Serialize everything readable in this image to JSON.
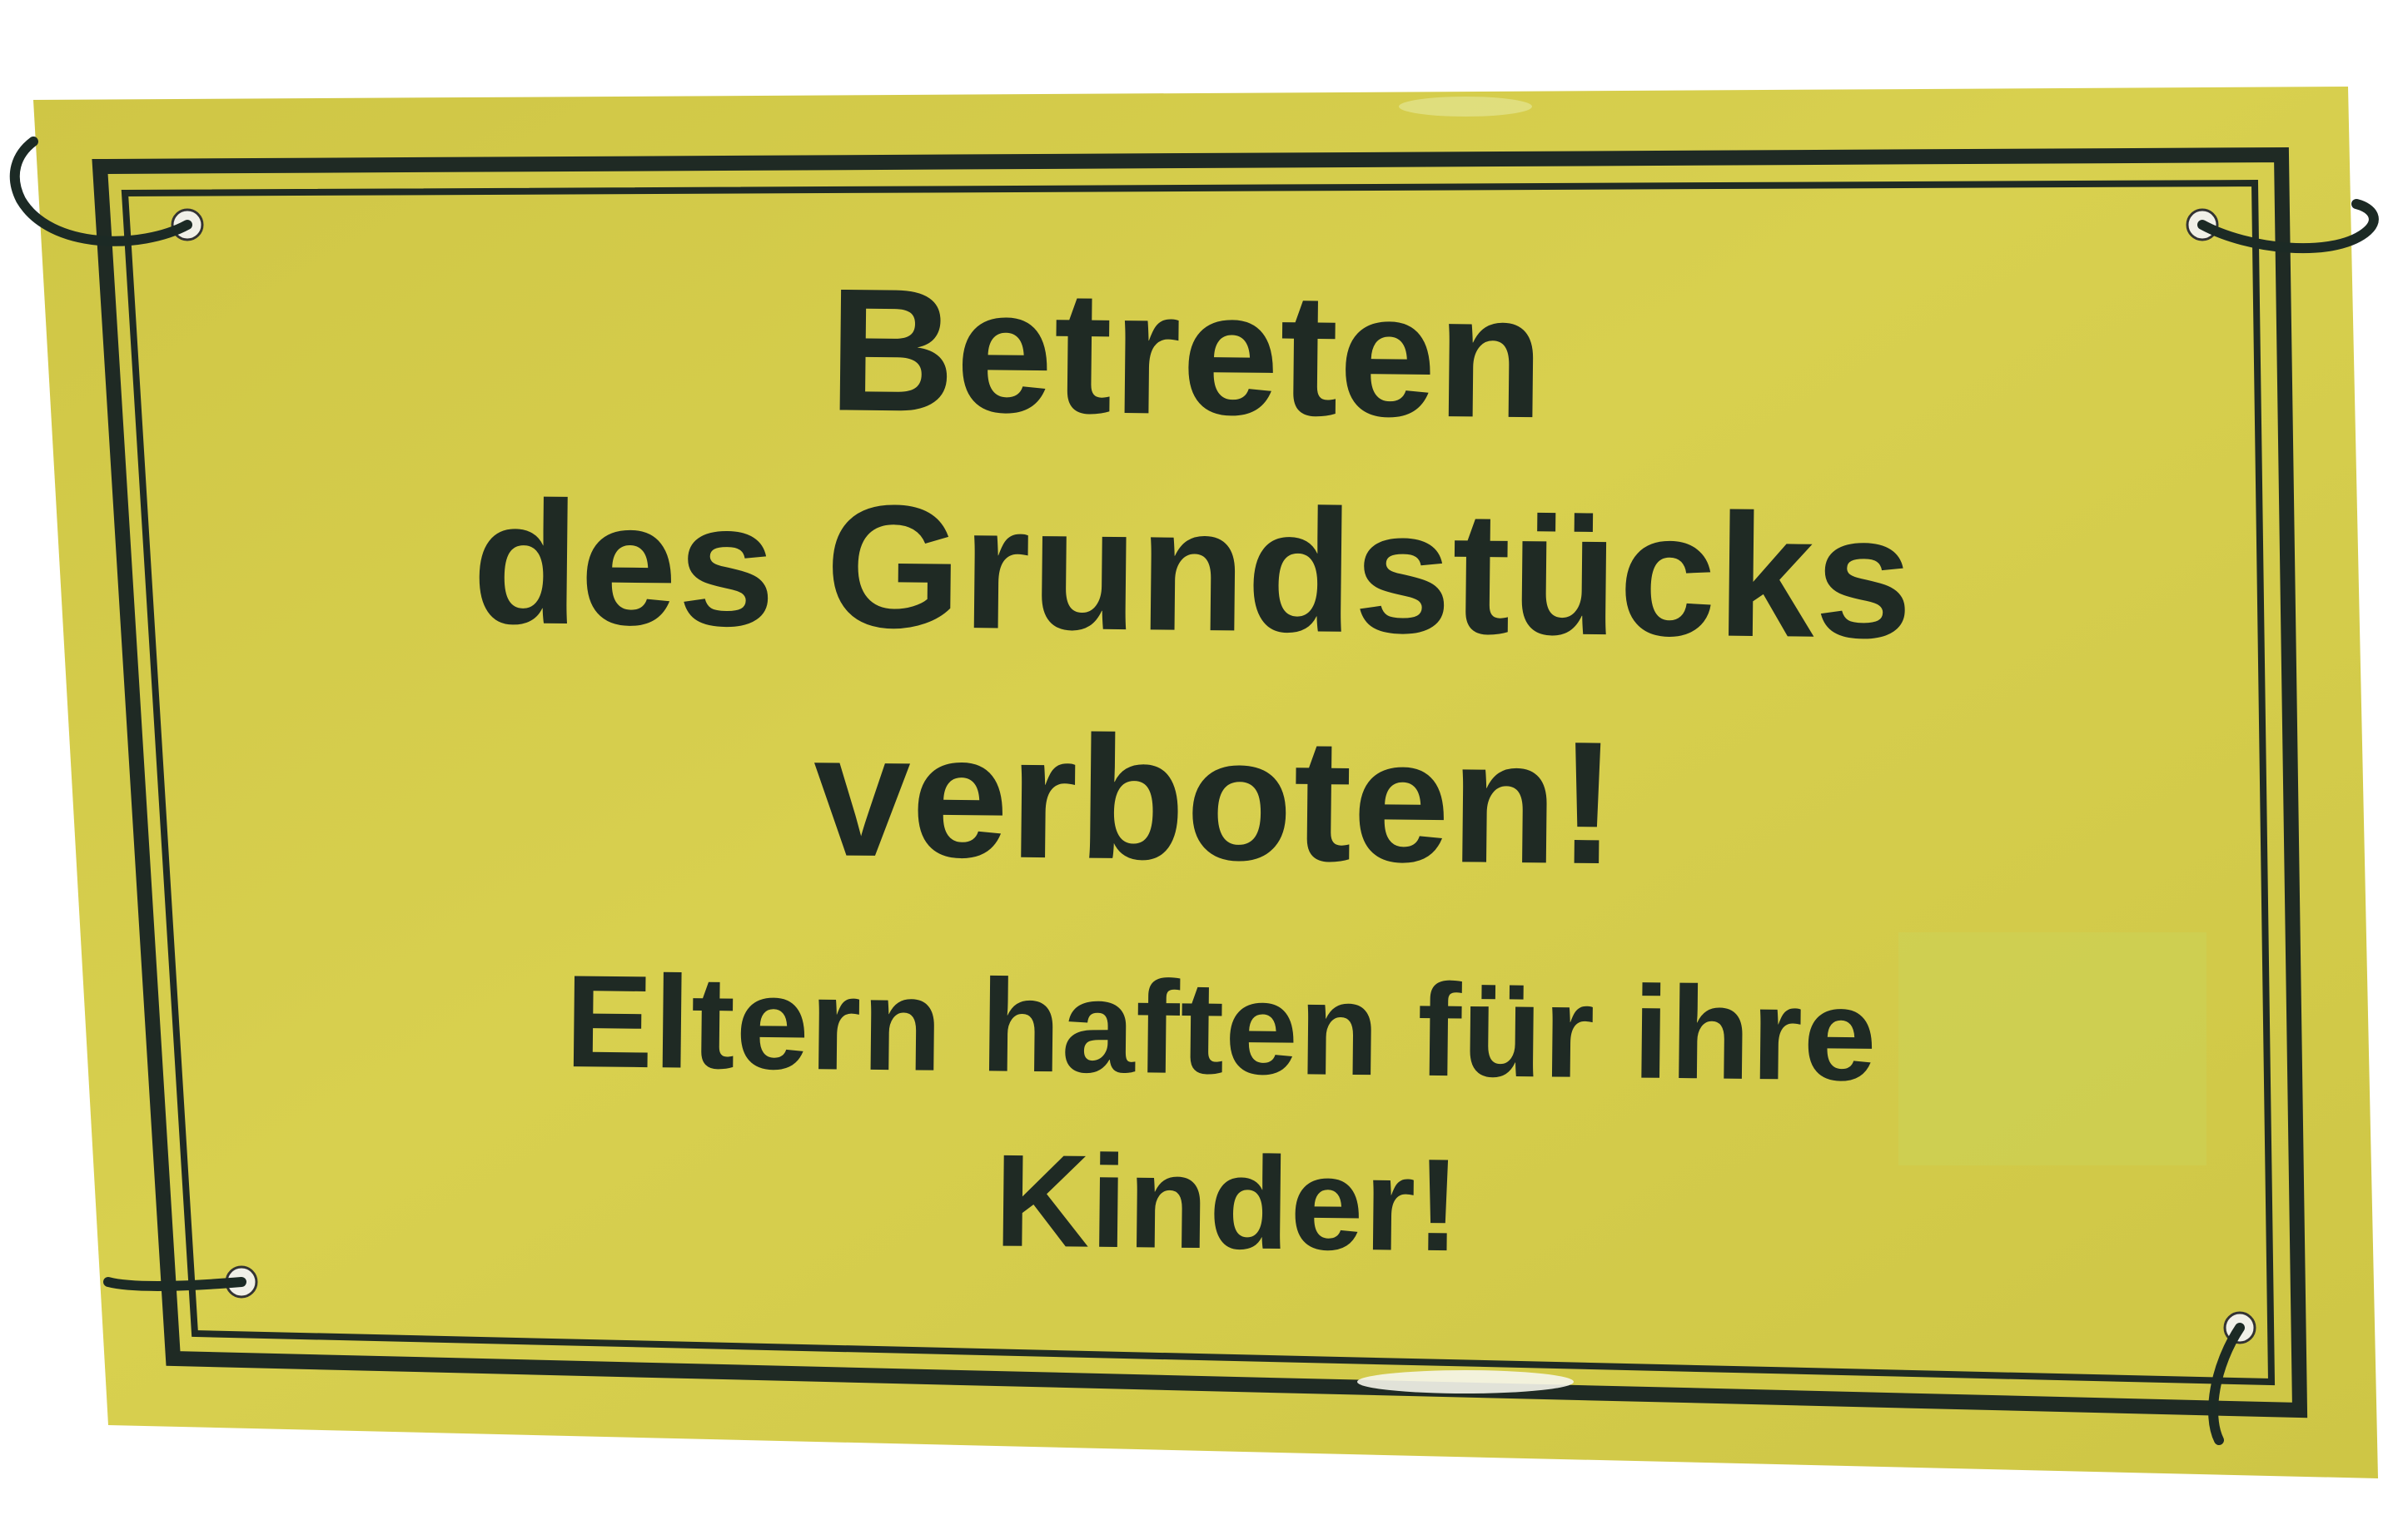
{
  "sign": {
    "line1": "Betreten",
    "line2": "des Grundstücks",
    "line3": "verboten!",
    "line4": "Eltern haften für ihre",
    "line5": "Kinder!"
  },
  "colors": {
    "board": "#d4cb45",
    "border": "#1f2a24",
    "text": "#1f2a24",
    "wire": "#1c2a25"
  }
}
